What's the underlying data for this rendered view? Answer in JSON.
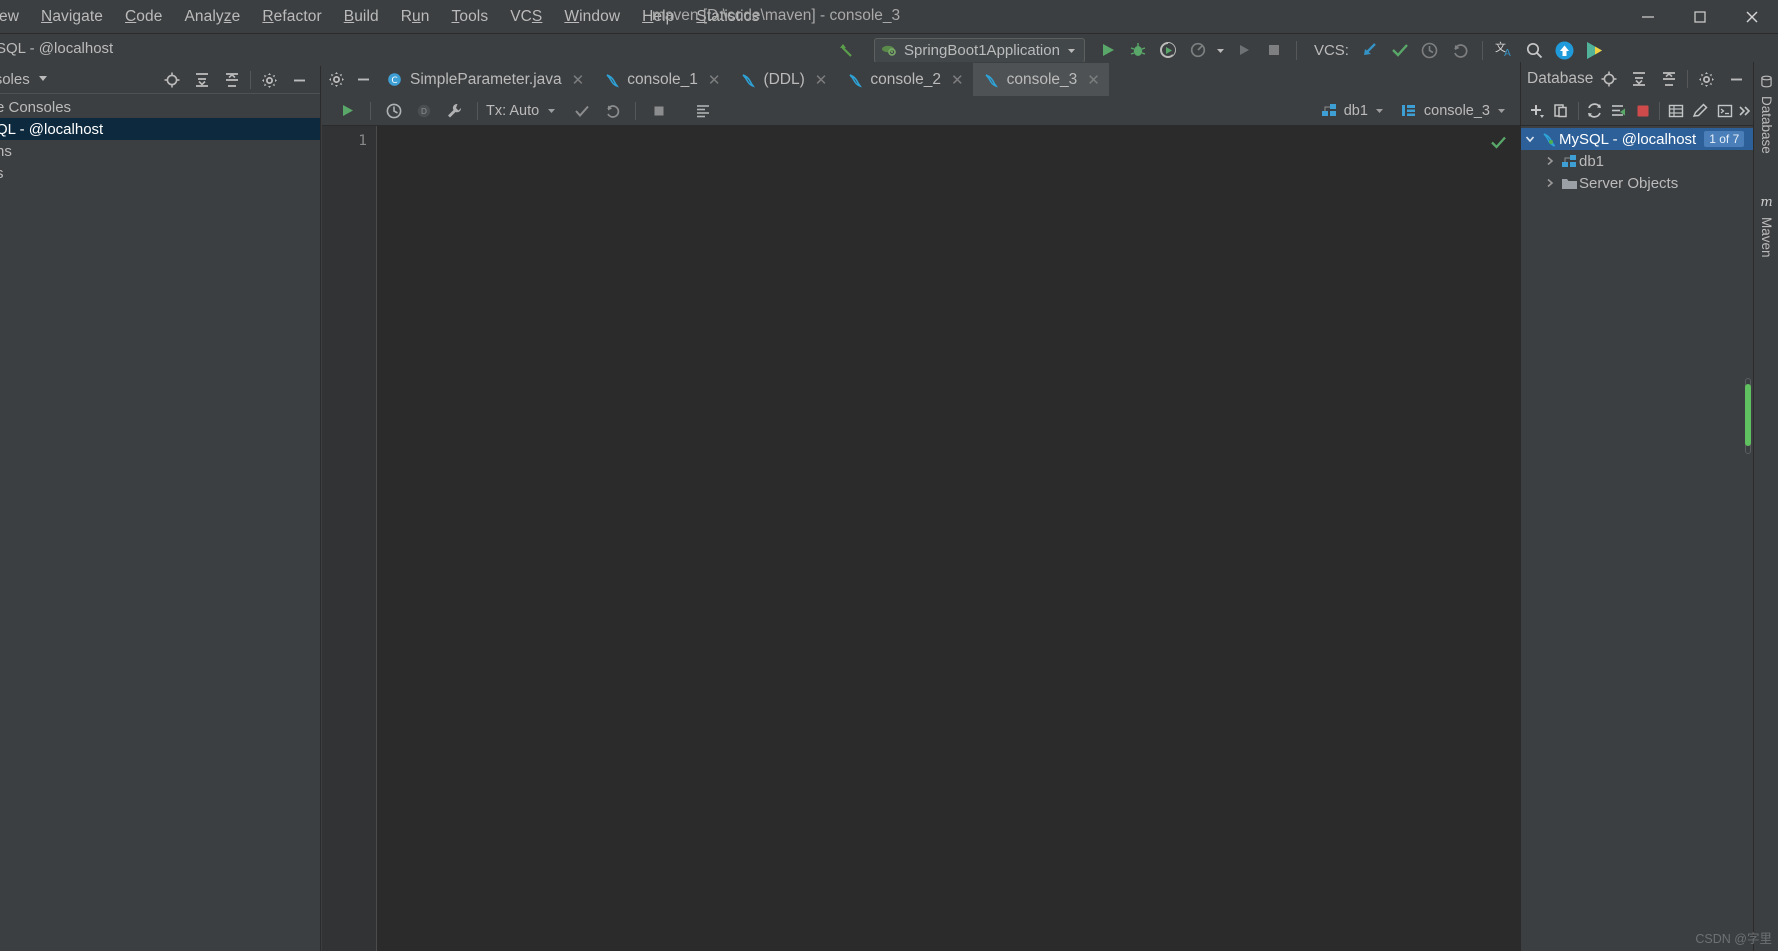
{
  "window": {
    "title": "maven [D:\\code\\maven] - console_3",
    "controls": {
      "minimize": "minimize-icon",
      "maximize": "maximize-icon",
      "close": "close-icon"
    }
  },
  "menubar": {
    "items": [
      {
        "label": "ew",
        "mnemonic": ""
      },
      {
        "label": "Navigate",
        "mnemonic": "N"
      },
      {
        "label": "Code",
        "mnemonic": "C"
      },
      {
        "label": "Analyze",
        "mnemonic": "z"
      },
      {
        "label": "Refactor",
        "mnemonic": "R"
      },
      {
        "label": "Build",
        "mnemonic": "B"
      },
      {
        "label": "Run",
        "mnemonic": "u"
      },
      {
        "label": "Tools",
        "mnemonic": "T"
      },
      {
        "label": "VCS",
        "mnemonic": "S"
      },
      {
        "label": "Window",
        "mnemonic": "W"
      },
      {
        "label": "Help",
        "mnemonic": "H"
      },
      {
        "label": "Statistics",
        "mnemonic": "S"
      }
    ]
  },
  "toolbar": {
    "left_title": "SQL - @localhost",
    "run_config": "SpringBoot1Application",
    "vcs_label": "VCS:",
    "icons": [
      "back-arrow-icon",
      "run-icon",
      "debug-icon",
      "run-coverage-icon",
      "profile-icon",
      "dropdown-icon",
      "rerun-icon",
      "stop-icon",
      "update-project-icon",
      "commit-icon",
      "history-icon",
      "rollback-icon",
      "translate-icon",
      "search-everywhere-icon",
      "upload-icon",
      "plugin-icon"
    ]
  },
  "left_panel": {
    "header_title": "and Consoles",
    "header_icons": [
      "locate-icon",
      "expand-all-icon",
      "collapse-all-icon",
      "settings-icon",
      "hide-icon"
    ],
    "rows": [
      {
        "label": "e Consoles",
        "selected": false
      },
      {
        "label": "QL - @localhost",
        "selected": true
      },
      {
        "label": "ns",
        "selected": false
      },
      {
        "label": "s",
        "selected": false
      }
    ]
  },
  "tabs": [
    {
      "label": "SimpleParameter.java",
      "icon": "java-class-icon",
      "active": false
    },
    {
      "label": "console_1",
      "icon": "mysql-dolphin-icon",
      "active": false
    },
    {
      "label": "(DDL)",
      "icon": "mysql-dolphin-icon",
      "active": false
    },
    {
      "label": "console_2",
      "icon": "mysql-dolphin-icon",
      "active": false
    },
    {
      "label": "console_3",
      "icon": "mysql-dolphin-icon",
      "active": true
    }
  ],
  "console_toolbar": {
    "tx_label": "Tx: Auto",
    "schema_chip": "db1",
    "session_chip": "console_3",
    "icons": [
      "execute-icon",
      "execute-history-icon",
      "stop-query-icon",
      "settings-wrench-icon",
      "commit-check-icon",
      "rollback-icon",
      "cancel-icon",
      "output-table-icon"
    ]
  },
  "editor": {
    "line_numbers": [
      "1"
    ],
    "content": "",
    "status_icon": "checkmark-ok-icon"
  },
  "database_panel": {
    "title": "Database",
    "header_icons": [
      "locate-icon",
      "expand-all-icon",
      "collapse-all-icon",
      "settings-icon",
      "hide-icon"
    ],
    "toolbar_icons": [
      "add-icon",
      "duplicate-icon",
      "refresh-icon",
      "sql-script-icon",
      "stop-icon",
      "table-icon",
      "edit-icon",
      "console-icon",
      "more-icon"
    ],
    "tree": [
      {
        "label": "MySQL - @localhost",
        "icon": "mysql-dolphin-icon",
        "expanded": true,
        "selected": true,
        "badge": "1 of 7",
        "indent": 0
      },
      {
        "label": "db1",
        "icon": "schema-icon",
        "expanded": false,
        "selected": false,
        "badge": "",
        "indent": 1
      },
      {
        "label": "Server Objects",
        "icon": "folder-icon",
        "expanded": false,
        "selected": false,
        "badge": "",
        "indent": 1
      }
    ]
  },
  "right_strip": {
    "tabs": [
      {
        "label": "Database",
        "icon": "database-icon"
      },
      {
        "label": "Maven",
        "icon": "maven-m-icon"
      }
    ]
  },
  "watermark": "CSDN @字里",
  "colors": {
    "bg": "#3c3f41",
    "editor_bg": "#2b2b2b",
    "accent_blue": "#2d6099",
    "selected_dark": "#0d293e",
    "green": "#5a9e4b",
    "dolphin": "#2ea3d8",
    "text": "#bbbbbb"
  }
}
